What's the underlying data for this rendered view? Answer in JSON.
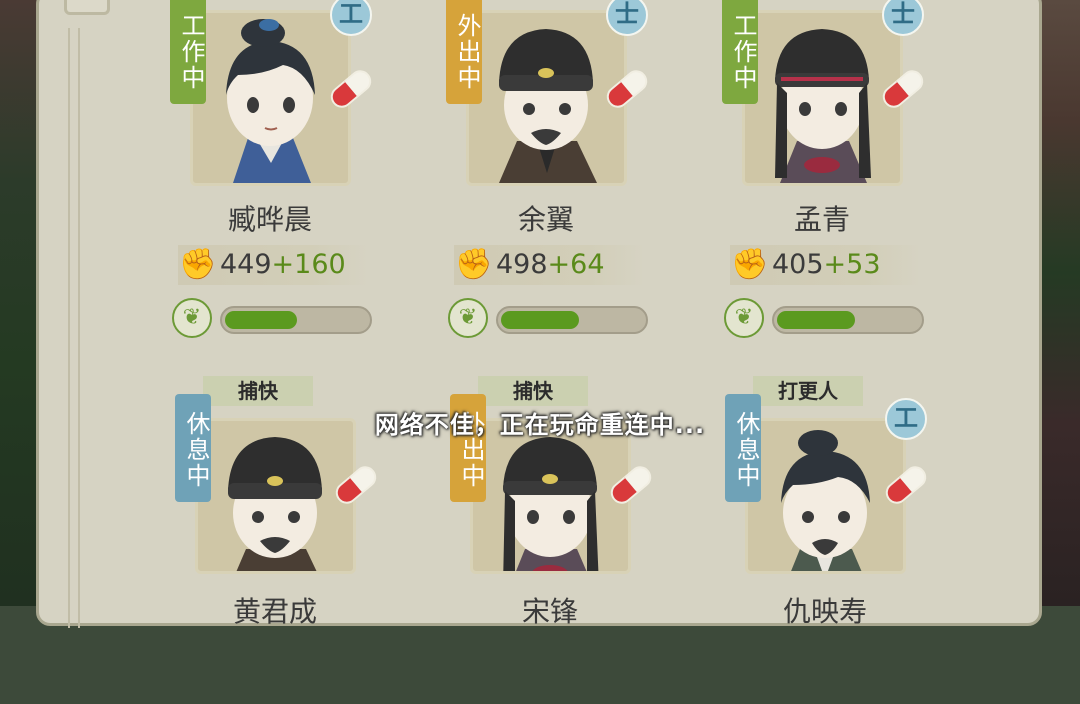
{
  "toast": "网络不佳，正在玩命重连中...",
  "row1": [
    {
      "status": "工作中",
      "status_color": "green",
      "class_badge": "工",
      "name": "臧晔晨",
      "stat_base": "449",
      "stat_bonus": "+160",
      "progress": 0.48
    },
    {
      "status": "外出中",
      "status_color": "orange",
      "class_badge": "士",
      "name": "余翼",
      "stat_base": "498",
      "stat_bonus": "+64",
      "progress": 0.52
    },
    {
      "status": "工作中",
      "status_color": "green",
      "class_badge": "士",
      "name": "孟青",
      "stat_base": "405",
      "stat_bonus": "+53",
      "progress": 0.52
    }
  ],
  "row2": [
    {
      "role": "捕快",
      "status": "休息中",
      "status_color": "blue",
      "class_badge": "",
      "name": "黄君成"
    },
    {
      "role": "捕快",
      "status": "外出中",
      "status_color": "orange",
      "class_badge": "",
      "name": "宋锋"
    },
    {
      "role": "打更人",
      "status": "休息中",
      "status_color": "blue",
      "class_badge": "工",
      "name": "仇映寿"
    }
  ],
  "icons": {
    "strength": "flexed-arm-icon",
    "stamina": "leaf-icon",
    "medicine": "pill-icon"
  },
  "colors": {
    "panel": "#d6d3c3",
    "progress": "#5b9a1f",
    "status_green": "#7ea83f",
    "status_orange": "#d6a33a",
    "status_blue": "#6fa2b7"
  }
}
